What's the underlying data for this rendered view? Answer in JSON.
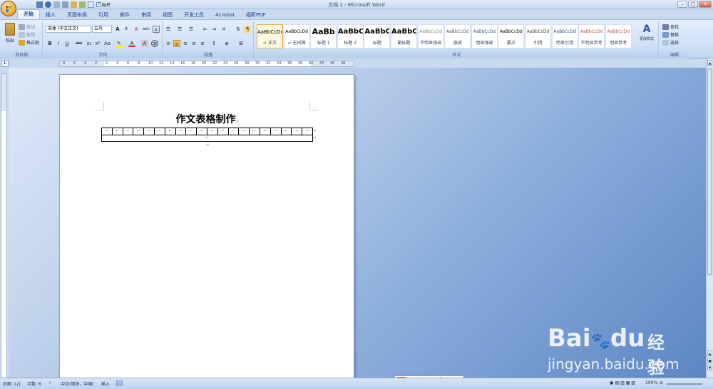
{
  "window": {
    "title": "文档 1 - Microsoft Word",
    "minimize": "–",
    "maximize": "□",
    "close": "✕"
  },
  "qat": {
    "ruler_checkbox_label": "标尺",
    "checked_mark": "✓"
  },
  "tabs": [
    {
      "label": "开始"
    },
    {
      "label": "插入"
    },
    {
      "label": "页面布局"
    },
    {
      "label": "引用"
    },
    {
      "label": "邮件"
    },
    {
      "label": "审阅"
    },
    {
      "label": "视图"
    },
    {
      "label": "开发工具"
    },
    {
      "label": "Acrobat"
    },
    {
      "label": "福昕PDF"
    }
  ],
  "clipboard": {
    "paste": "粘贴",
    "cut": "剪切",
    "copy": "复制",
    "format_painter": "格式刷",
    "group_label": "剪贴板"
  },
  "font": {
    "font_name": "宋体 (中文正文)",
    "font_size": "五号",
    "group_label": "字体",
    "bold": "B",
    "italic": "I",
    "underline": "U",
    "strike": "abe",
    "sub": "x₂",
    "sup": "x²",
    "case": "Aa",
    "grow": "A",
    "shrink": "A",
    "clear": "A",
    "char_border": "A",
    "phonetic": "wén",
    "enclose": "字"
  },
  "paragraph": {
    "group_label": "段落"
  },
  "styles": {
    "group_label": "样式",
    "items": [
      {
        "sample": "AaBbCcDd",
        "name": "↵ 正文",
        "active": true
      },
      {
        "sample": "AaBbCcDd",
        "name": "↵ 无间隔"
      },
      {
        "sample": "AaBb",
        "name": "标题 1"
      },
      {
        "sample": "AaBbC",
        "name": "标题 2"
      },
      {
        "sample": "AaBbC",
        "name": "标题"
      },
      {
        "sample": "AaBbC",
        "name": "副标题"
      },
      {
        "sample": "AaBbCcDd",
        "name": "不明显强调"
      },
      {
        "sample": "AaBbCcDd",
        "name": "强调"
      },
      {
        "sample": "AaBbCcDd",
        "name": "明显强调"
      },
      {
        "sample": "AaBbCcDd",
        "name": "要点"
      },
      {
        "sample": "AaBbCcDd",
        "name": "引用"
      },
      {
        "sample": "AaBbCcDd",
        "name": "明显引用"
      },
      {
        "sample": "AaBbCcDd",
        "name": "不明显参考"
      },
      {
        "sample": "AaBbCcDd",
        "name": "明显参考"
      }
    ],
    "change_styles": "更改样式"
  },
  "editing": {
    "find": "查找",
    "replace": "替换",
    "select": "选择",
    "group_label": "编辑"
  },
  "ruler": {
    "ticks": [
      "8",
      "6",
      "4",
      "2",
      "2",
      "4",
      "6",
      "8",
      "10",
      "12",
      "14",
      "16",
      "18",
      "20",
      "22",
      "24",
      "26",
      "28",
      "30",
      "32",
      "34",
      "36",
      "38",
      "42",
      "44",
      "46",
      "48"
    ]
  },
  "document": {
    "title": "作文表格制作",
    "para_mark": "↵",
    "table_cols": 20
  },
  "statusbar": {
    "page": "页面: 1/1",
    "words": "字数: 6",
    "lang": "中文(简体，中国)",
    "mode": "插入",
    "zoom": "100%"
  },
  "ime": {
    "logo": "S",
    "mode": "中"
  },
  "watermark": {
    "brand": "Bai",
    "brand2": "du",
    "cn": "经验",
    "url": "jingyan.baidu.com"
  },
  "colors": {
    "accent": "#15428b",
    "ribbon": "#cfe0f5",
    "workspace": "#5d86c3"
  }
}
